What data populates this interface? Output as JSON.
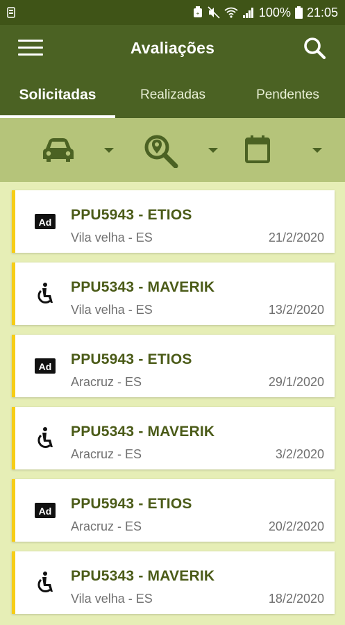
{
  "status_bar": {
    "battery_percent": "100%",
    "time": "21:05"
  },
  "app_bar": {
    "title": "Avaliações",
    "menu_icon": "menu-icon",
    "search_icon": "search-icon"
  },
  "tabs": [
    {
      "label": "Solicitadas",
      "active": true
    },
    {
      "label": "Realizadas",
      "active": false
    },
    {
      "label": "Pendentes",
      "active": false
    }
  ],
  "filters": [
    {
      "icon": "car-icon"
    },
    {
      "icon": "location-search-icon"
    },
    {
      "icon": "calendar-icon"
    }
  ],
  "items": [
    {
      "title": "PPU5943 - ETIOS",
      "city": "Vila velha - ES",
      "date": "21/2/2020",
      "icon": "ad-icon"
    },
    {
      "title": "PPU5343 - MAVERIK",
      "city": "Vila velha - ES",
      "date": "13/2/2020",
      "icon": "accessibility-icon"
    },
    {
      "title": "PPU5943 - ETIOS",
      "city": "Aracruz - ES",
      "date": "29/1/2020",
      "icon": "ad-icon"
    },
    {
      "title": "PPU5343 - MAVERIK",
      "city": "Aracruz - ES",
      "date": "3/2/2020",
      "icon": "accessibility-icon"
    },
    {
      "title": "PPU5943 - ETIOS",
      "city": "Aracruz - ES",
      "date": "20/2/2020",
      "icon": "ad-icon"
    },
    {
      "title": "PPU5343 - MAVERIK",
      "city": "Vila velha - ES",
      "date": "18/2/2020",
      "icon": "accessibility-icon"
    }
  ],
  "colors": {
    "primary": "#4b6223",
    "status_bar": "#3f5417",
    "filter_bar": "#b5c47a",
    "background": "#e6eeb6",
    "accent": "#f6cd16",
    "title_text": "#4b5b18"
  }
}
